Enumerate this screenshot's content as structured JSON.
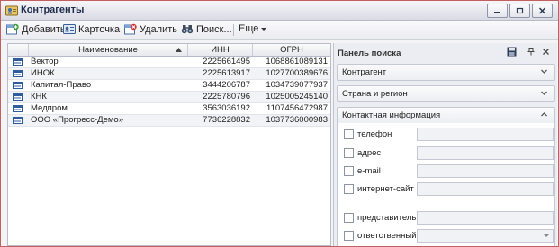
{
  "window": {
    "title": "Контрагенты",
    "controls": [
      "minimize-icon",
      "restore-icon",
      "close-icon"
    ]
  },
  "toolbar": {
    "add_label": "Добавить",
    "card_label": "Карточка",
    "delete_label": "Удалить",
    "search_label": "Поиск...",
    "more_label": "Еще"
  },
  "grid": {
    "columns": [
      "Наименование",
      "ИНН",
      "ОГРН"
    ],
    "rows": [
      {
        "name": "Вектор",
        "inn": "2225661495",
        "ogrn": "1068861089131"
      },
      {
        "name": "ИНОК",
        "inn": "2225613917",
        "ogrn": "1027700389676"
      },
      {
        "name": "Капитал-Право",
        "inn": "3444206787",
        "ogrn": "1034739077937"
      },
      {
        "name": "КНК",
        "inn": "2225780796",
        "ogrn": "1025005245140"
      },
      {
        "name": "Медпром",
        "inn": "3563036192",
        "ogrn": "1107456472987"
      },
      {
        "name": "ООО «Прогресс-Демо»",
        "inn": "7736228832",
        "ogrn": "1037736000983"
      }
    ]
  },
  "search_panel": {
    "title": "Панель поиска",
    "sections": [
      "Контрагент",
      "Страна и регион",
      "Контактная информация"
    ],
    "fields": [
      "телефон",
      "адрес",
      "e-mail",
      "интернет-сайт",
      "представитель",
      "ответственный"
    ]
  },
  "colors": {
    "accent": "#1f5fb4",
    "border": "#c25f5f"
  }
}
